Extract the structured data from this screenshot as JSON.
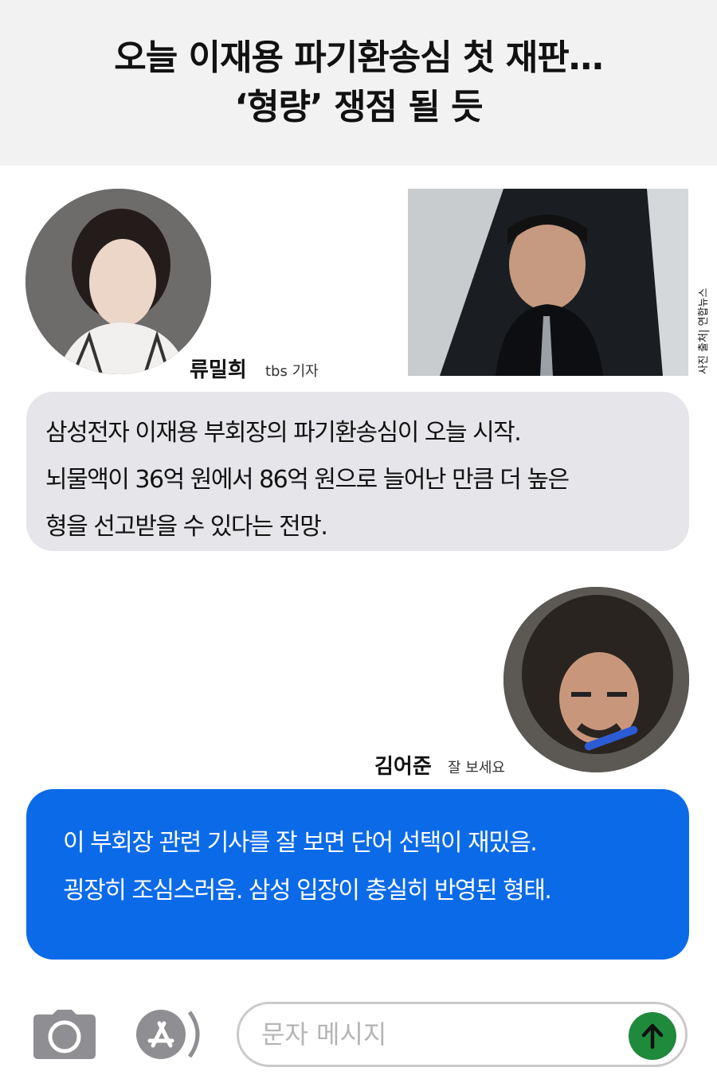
{
  "header": {
    "title_line1": "오늘 이재용 파기환송심 첫 재판…",
    "title_line2": "‘형량’ 쟁점 될 듯"
  },
  "speaker1": {
    "name": "류밀희",
    "role": "tbs 기자",
    "icon": "reporter-avatar"
  },
  "photo": {
    "credit": "사진 출처| 연합뉴스",
    "icon": "news-photo"
  },
  "message1": {
    "lines": [
      "삼성전자 이재용 부회장의 파기환송심이 오늘 시작.",
      "뇌물액이 36억 원에서 86억 원으로 늘어난 만큼 더 높은",
      "형을 선고받을 수 있다는 전망."
    ]
  },
  "speaker2": {
    "name": "김어준",
    "role": "잘 보세요",
    "icon": "host-avatar"
  },
  "message2": {
    "lines": [
      "이 부회장 관련 기사를 잘 보면 단어 선택이 재밌음.",
      "굉장히 조심스러움. 삼성 입장이 충실히 반영된 형태."
    ]
  },
  "composer": {
    "placeholder": "문자 메시지",
    "camera_icon": "camera-icon",
    "appstore_icon": "appstore-icon",
    "send_icon": "send-arrow-icon"
  },
  "colors": {
    "header_bg": "#f2f2f2",
    "gray_bubble": "#e5e5ea",
    "blue_bubble": "#0b6ae8",
    "send_button": "#1f8a3b"
  }
}
